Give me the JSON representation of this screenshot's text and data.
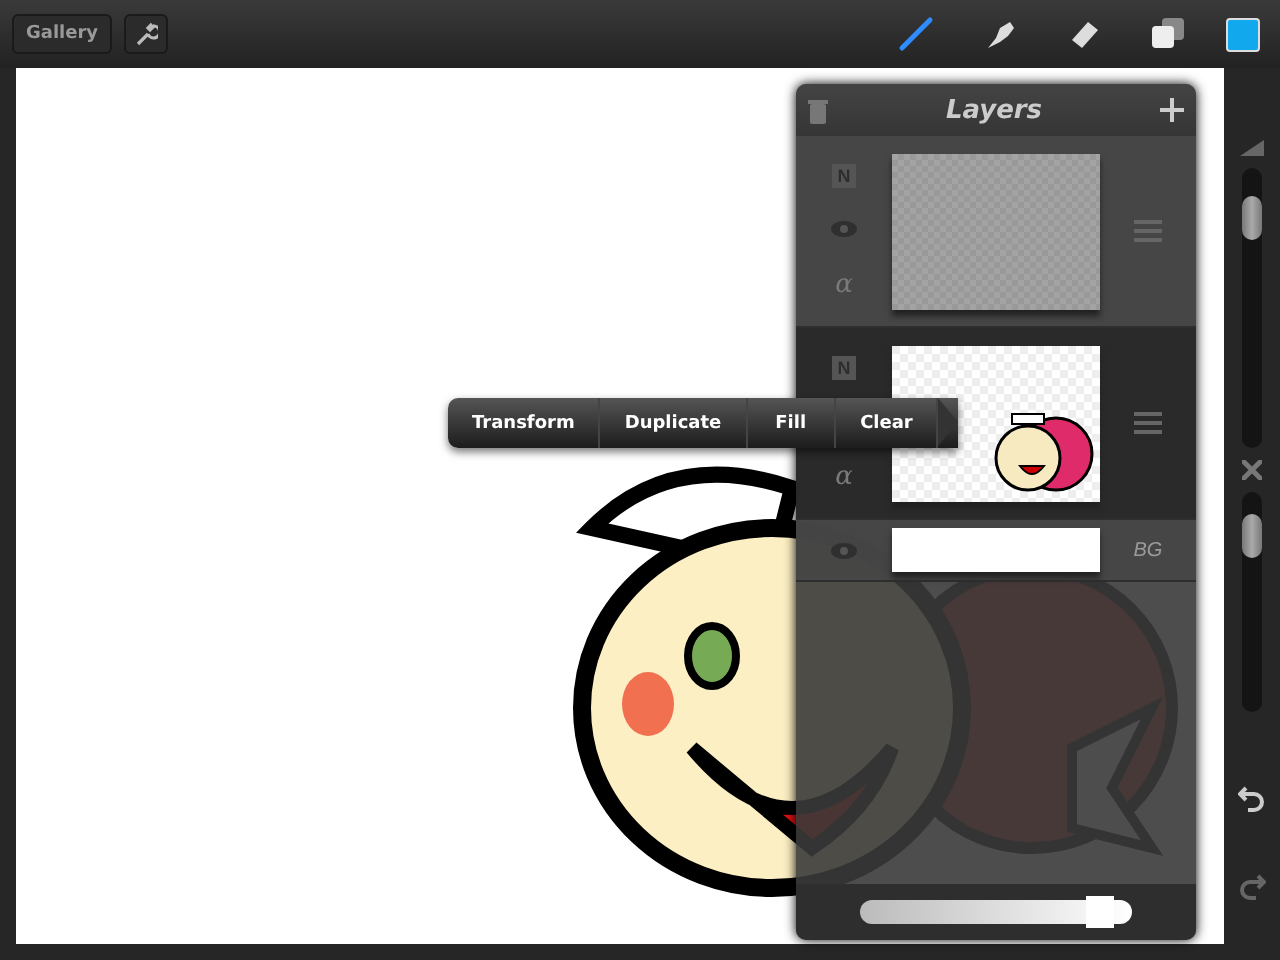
{
  "toolbar": {
    "gallery_button": "Gallery",
    "tools": [
      {
        "kind": "brush",
        "selected": true
      },
      {
        "kind": "smudge",
        "selected": false
      },
      {
        "kind": "eraser",
        "selected": false
      },
      {
        "kind": "layers",
        "selected": false
      }
    ],
    "color_swatch": {
      "color": "#12a8ee"
    }
  },
  "context_menu": [
    "Transform",
    "Duplicate",
    "Fill",
    "Clear"
  ],
  "layers_panel": {
    "title": "Layers",
    "layers": [
      {
        "kind": "layer",
        "blend": "N",
        "alpha": "α",
        "selected": false,
        "empty": true
      },
      {
        "kind": "layer",
        "blend": "N",
        "alpha": "α",
        "selected": true,
        "empty": false
      },
      {
        "kind": "background",
        "label": "BG"
      }
    ],
    "opacity": {
      "level": 0.93
    }
  },
  "sidebar": {
    "brush_size": {
      "level": 0.88
    },
    "brush_opacity": {
      "level": 0.88
    }
  }
}
